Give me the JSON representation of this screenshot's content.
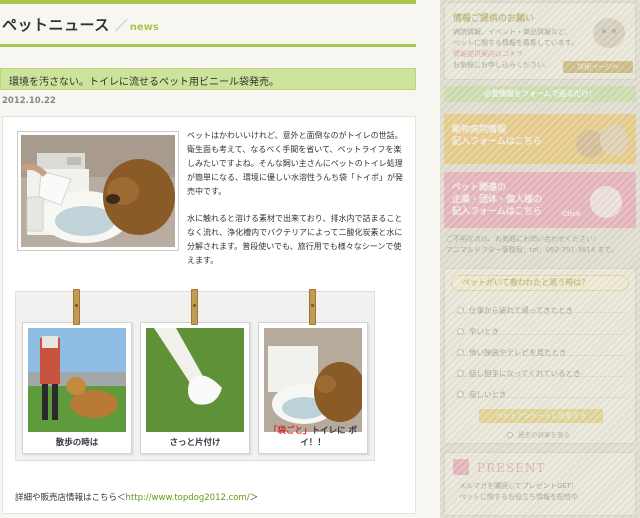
{
  "page": {
    "section_title": "ペットニュース",
    "section_slash": "／",
    "section_tag": "news"
  },
  "article": {
    "headline": "環境を汚さない。トイレに流せるペット用ビニール袋発売。",
    "date": "2012.10.22",
    "paragraph1": "ペットはかわいいけれど、意外と面倒なのがトイレの世話。衛生面も考えて、なるべく手間を省いて、ペットライフを楽しみたいですよね。そんな飼い主さんにペットのトイレ処理が簡単になる、環境に優しい水溶性うんち袋「トイポ」が発売中です。",
    "paragraph2": "水に触れると溶ける素材で出来ており、排水内で詰まることなく流れ、浄化槽内でバクテリアによって二酸化炭素と水に分解されます。普段使いでも、旅行用でも様々なシーンで使えます。",
    "captions": [
      {
        "text": "散歩の時は"
      },
      {
        "text": "さっと片付け"
      },
      {
        "accent": "「袋ごと」",
        "rest": "トイレに ポイ！！"
      }
    ],
    "details_prefix": "詳細や販売店情報はこちら＜",
    "details_link": "http://www.topdog2012.com/",
    "details_suffix": "＞"
  },
  "sidebar": {
    "notice": {
      "title": "情報ご提供のお願い",
      "lines": [
        "病院情報、イベント・商品情報など、",
        "ペットに関する情報を募集しています。",
        "情報提供案内はコチラ",
        "お気軽にお申し込みください。"
      ],
      "button": "詳細ページへ"
    },
    "form_heading": "必要情報をフォームで送るだけ！",
    "banner_hospital": [
      "動物病院情報",
      "記入フォームはこちら"
    ],
    "banner_event": [
      "ペット関連の",
      "企業・団体・個人様の",
      "記入フォームはこちら"
    ],
    "banner_click": "Click",
    "contact": [
      "ご不明な点は、お気軽にお問い合わせください！",
      "アニマルドクター事務局：tel：092-791-3614 まで。"
    ],
    "poll": {
      "title": "ペットがいて救われたと思う時は？",
      "options": [
        "仕事から疲れて帰ってきたとき",
        "辛いとき",
        "怖い映画やテレビを見たとき",
        "話し相手になってくれているとき",
        "寂しいとき"
      ],
      "submit": "ペットアンケートに投票する",
      "results": "過去の結果を見る"
    },
    "present": {
      "title": "PRESENT",
      "lines": [
        "メルマガを購読してプレゼントGET！",
        "ペットに関するお役立ち情報を配信中"
      ]
    }
  },
  "colors": {
    "accent_green": "#a9c74a",
    "headline_bg": "#cde29a",
    "link_green": "#669911",
    "caption_red": "#d62a2a"
  }
}
